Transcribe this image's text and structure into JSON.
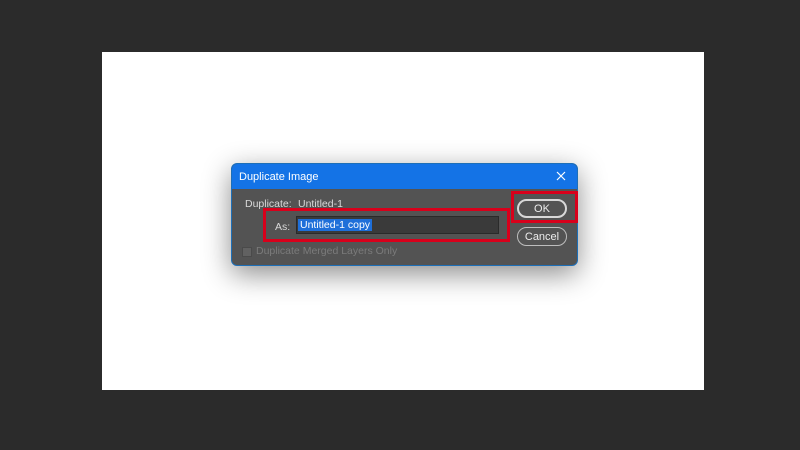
{
  "dialog": {
    "title": "Duplicate Image",
    "duplicate_label": "Duplicate:",
    "duplicate_value": "Untitled-1",
    "as_label": "As:",
    "as_value": "Untitled-1 copy",
    "merged_label": "Duplicate Merged Layers Only",
    "merged_checked": false,
    "ok_label": "OK",
    "cancel_label": "Cancel",
    "close_icon": "close-icon"
  },
  "colors": {
    "titlebar": "#1473e6",
    "dialog_bg": "#535353",
    "selection": "#1e6fd9",
    "highlight": "#d8001b",
    "workspace": "#2b2b2b",
    "canvas": "#ffffff"
  }
}
